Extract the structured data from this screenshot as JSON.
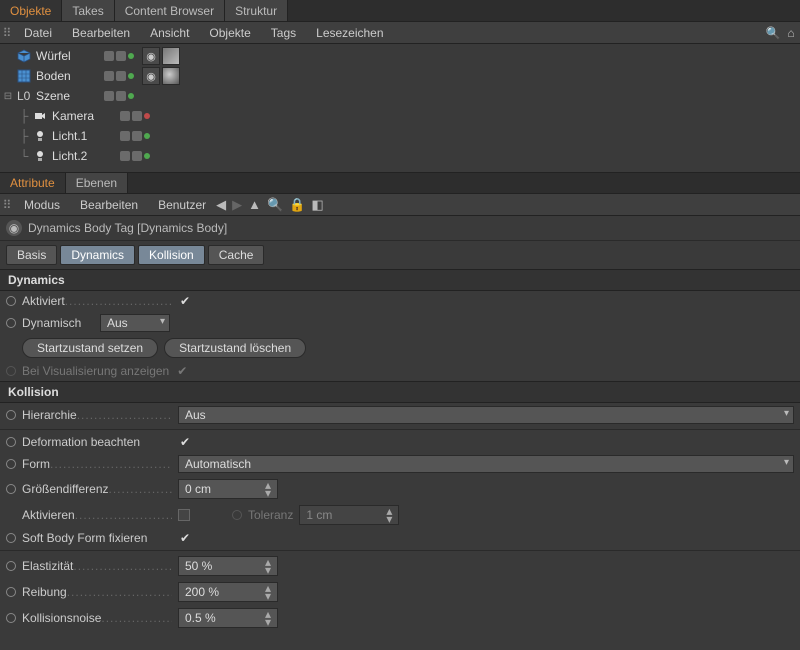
{
  "top_tabs": {
    "objekte": "Objekte",
    "takes": "Takes",
    "content": "Content Browser",
    "struktur": "Struktur"
  },
  "obj_menu": {
    "datei": "Datei",
    "bearbeiten": "Bearbeiten",
    "ansicht": "Ansicht",
    "objekte": "Objekte",
    "tags": "Tags",
    "lesezeichen": "Lesezeichen"
  },
  "tree": {
    "wuerfel": "Würfel",
    "boden": "Boden",
    "szene": "Szene",
    "kamera": "Kamera",
    "licht1": "Licht.1",
    "licht2": "Licht.2"
  },
  "attr_tabs": {
    "attribute": "Attribute",
    "ebenen": "Ebenen"
  },
  "attr_menu": {
    "modus": "Modus",
    "bearbeiten": "Bearbeiten",
    "benutzer": "Benutzer"
  },
  "title": "Dynamics Body Tag [Dynamics Body]",
  "subtabs": {
    "basis": "Basis",
    "dynamics": "Dynamics",
    "kollision": "Kollision",
    "cache": "Cache"
  },
  "dynamics": {
    "heading": "Dynamics",
    "aktiviert_label": "Aktiviert",
    "dynamisch_label": "Dynamisch",
    "dynamisch_value": "Aus",
    "btn_set": "Startzustand setzen",
    "btn_clear": "Startzustand löschen",
    "visualize_label": "Bei Visualisierung anzeigen"
  },
  "kollision": {
    "heading": "Kollision",
    "hierarchie_label": "Hierarchie",
    "hierarchie_value": "Aus",
    "deformation_label": "Deformation beachten",
    "form_label": "Form",
    "form_value": "Automatisch",
    "groesse_label": "Größendifferenz",
    "groesse_value": "0 cm",
    "aktivieren_label": "Aktivieren",
    "toleranz_label": "Toleranz",
    "toleranz_value": "1 cm",
    "softbody_label": "Soft Body Form fixieren",
    "elast_label": "Elastizität",
    "elast_value": "50 %",
    "reibung_label": "Reibung",
    "reibung_value": "200 %",
    "noise_label": "Kollisionsnoise",
    "noise_value": "0.5 %"
  }
}
